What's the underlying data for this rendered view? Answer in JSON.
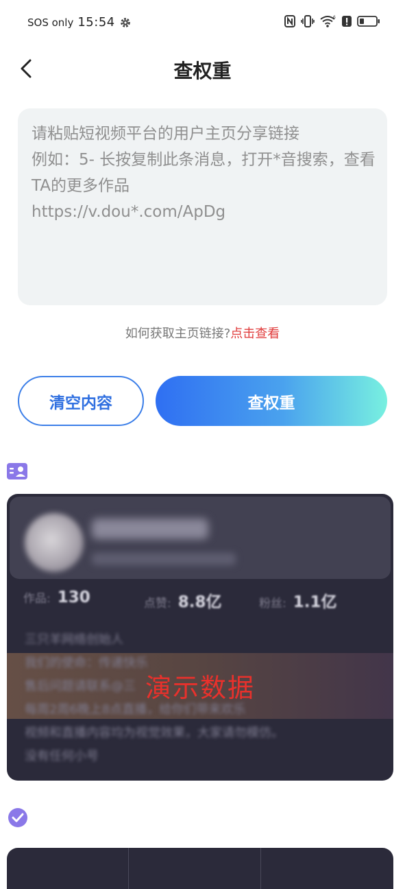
{
  "status_bar": {
    "carrier": "SOS only",
    "time": "15:54"
  },
  "header": {
    "title": "查权重"
  },
  "link_input": {
    "placeholder": "请粘贴短视频平台的用户主页分享链接\n例如：5- 长按复制此条消息，打开*音搜索，查看TA的更多作品\nhttps://v.dou*.com/ApDg"
  },
  "help": {
    "question": "如何获取主页链接?",
    "link_text": "点击查看"
  },
  "buttons": {
    "clear_label": "清空内容",
    "check_label": "查权重"
  },
  "profile_card": {
    "stats": [
      {
        "label": "作品:",
        "value": "130"
      },
      {
        "label": "点赞:",
        "value": "8.8亿"
      },
      {
        "label": "粉丝:",
        "value": "1.1亿"
      }
    ],
    "bio_lines": [
      "三只羊网络创始人",
      "我们的使命：传递快乐",
      "售后问题请联系@三",
      "每周2周6晚上8点直播，给你们带来欢乐",
      "视频和直播内容均为视觉效果，大家请勿模仿。",
      "没有任何小号"
    ],
    "demo_label": "演示数据"
  },
  "colors": {
    "accent_blue": "#2f6fe0",
    "accent_red": "#e03a3a",
    "card_bg": "#2b2a3a"
  }
}
